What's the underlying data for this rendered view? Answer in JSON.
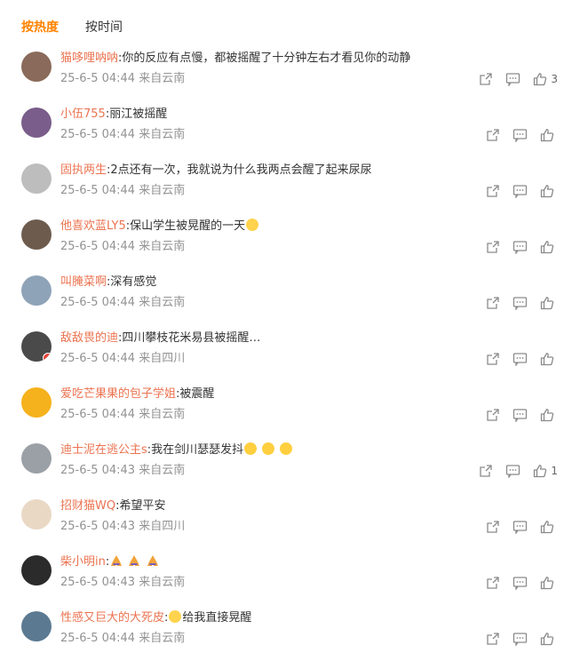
{
  "tabs": {
    "hot": "按热度",
    "time": "按时间"
  },
  "comments": [
    {
      "name": "猫哆哩呐呐",
      "text": ":你的反应有点慢，都被摇醒了十分钟左右才看见你的动静",
      "time": "25-6-5 04:44",
      "from": "来自云南",
      "likes": "3",
      "avatar_color": "#8a6a5a"
    },
    {
      "name": "小伍755",
      "text": ":丽江被摇醒",
      "time": "25-6-5 04:44",
      "from": "来自云南",
      "likes": "",
      "avatar_color": "#7a5d8a"
    },
    {
      "name": "固执两生",
      "text": ":2点还有一次，我就说为什么我两点会醒了起来尿尿",
      "time": "25-6-5 04:44",
      "from": "来自云南",
      "likes": "",
      "avatar_color": "#bdbdbd"
    },
    {
      "name": "他喜欢蓝LY5",
      "text": ":保山学生被晃醒的一天",
      "time": "25-6-5 04:44",
      "from": "来自云南",
      "likes": "",
      "avatar_color": "#6d5c4e",
      "emoji": "cry-laugh"
    },
    {
      "name": "叫腌菜啊",
      "text": ":深有感觉",
      "time": "25-6-5 04:44",
      "from": "来自云南",
      "likes": "",
      "avatar_color": "#8fa3b8"
    },
    {
      "name": "敌敌畏的迪",
      "text": ":四川攀枝花米易县被摇醒…",
      "time": "25-6-5 04:44",
      "from": "来自四川",
      "likes": "",
      "avatar_color": "#4a4a4a"
    },
    {
      "name": "爱吃芒果果的包子学姐",
      "text": ":被震醒",
      "time": "25-6-5 04:44",
      "from": "来自云南",
      "likes": "",
      "avatar_color": "#f5b21c"
    },
    {
      "name": "迪士泥在逃公主s",
      "text": ":我在剑川瑟瑟发抖",
      "time": "25-6-5 04:43",
      "from": "来自云南",
      "likes": "1",
      "avatar_color": "#9aa0a6",
      "emoji": "tears-3"
    },
    {
      "name": "招财猫WQ",
      "text": ":希望平安",
      "time": "25-6-5 04:43",
      "from": "来自四川",
      "likes": "",
      "avatar_color": "#e9d8c4"
    },
    {
      "name": "柴小明in",
      "text": ":",
      "time": "25-6-5 04:43",
      "from": "来自云南",
      "likes": "",
      "avatar_color": "#2b2b2b",
      "emoji": "pray-3"
    },
    {
      "name": "性感又巨大的大死皮",
      "text": ":给我直接晃醒",
      "time": "25-6-5 04:44",
      "from": "来自云南",
      "likes": "",
      "avatar_color": "#5b7a92",
      "emoji": "cry-laugh-before"
    }
  ]
}
